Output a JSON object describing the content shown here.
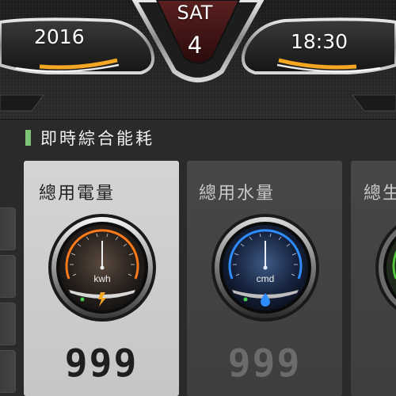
{
  "header": {
    "year": "2016",
    "day": "SAT",
    "date": "4",
    "time": "18:30"
  },
  "section": {
    "title": "即時綜合能耗",
    "accent_color": "#7cc576"
  },
  "cards": [
    {
      "title": "總用電量",
      "unit": "kwh",
      "value": "999",
      "accent_color": "#ff7a1a",
      "icon": "lightning-icon",
      "selected": true
    },
    {
      "title": "總用水量",
      "unit": "cmd",
      "value": "999",
      "accent_color": "#2f8cff",
      "icon": "water-drop-icon",
      "selected": false
    },
    {
      "title": "總生",
      "accent_color": "#52c23a",
      "selected": false
    }
  ],
  "colors": {
    "header_accent_orange": "#f5a623",
    "indicator_green": "#43d14a"
  }
}
